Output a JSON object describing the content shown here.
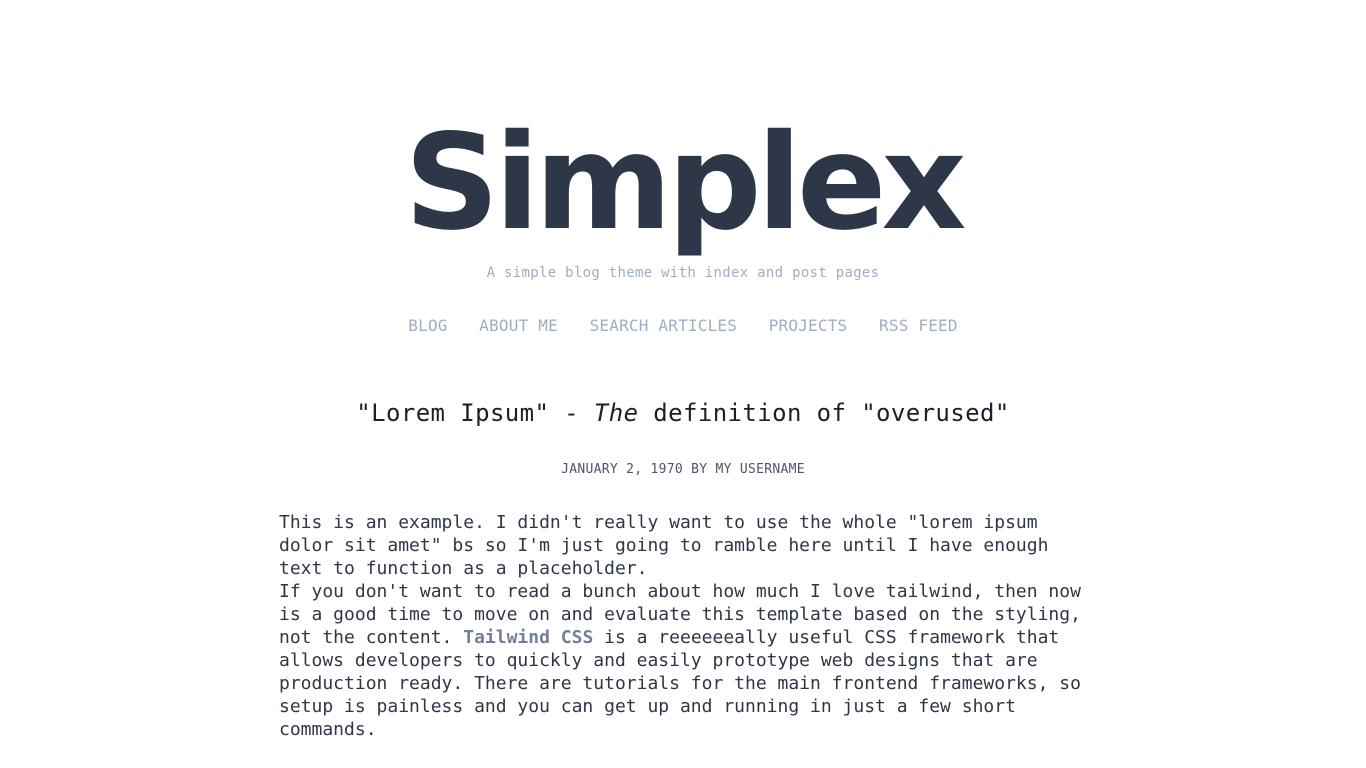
{
  "site": {
    "logo": "Simplex",
    "tagline": "A simple blog theme with index and post pages"
  },
  "nav": {
    "items": [
      {
        "label": "BLOG"
      },
      {
        "label": "ABOUT ME"
      },
      {
        "label": "SEARCH ARTICLES"
      },
      {
        "label": "PROJECTS"
      },
      {
        "label": "RSS FEED"
      }
    ]
  },
  "post": {
    "title_part1": "\"Lorem Ipsum\" - ",
    "title_em": "The",
    "title_part2": " definition of \"overused\"",
    "meta": "JANUARY 2, 1970 BY MY USERNAME",
    "paragraph1": "This is an example. I didn't really want to use the whole \"lorem ipsum dolor sit amet\" bs so I'm just going to ramble here until I have enough text to function as a placeholder.",
    "paragraph2_before": "If you don't want to read a bunch about how much I love tailwind, then now is a good time to move on and evaluate this template based on the styling, not the content. ",
    "paragraph2_link": "Tailwind CSS",
    "paragraph2_after": " is a reeeeeeally useful CSS framework that allows developers to quickly and easily prototype web designs that are production ready. There are tutorials for the main frontend frameworks, so setup is painless and you can get up and running in just a few short commands."
  },
  "colors": {
    "logo": "#2d3748",
    "muted": "#a0aec0",
    "link": "#718096",
    "text": "#2d3748"
  }
}
